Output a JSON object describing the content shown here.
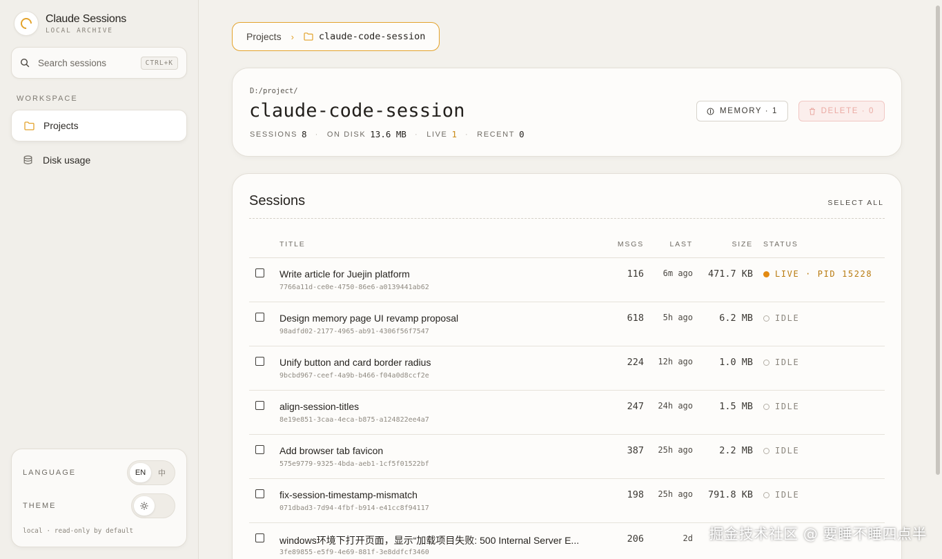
{
  "brand": {
    "title": "Claude Sessions",
    "subtitle": "LOCAL ARCHIVE"
  },
  "search": {
    "placeholder": "Search sessions",
    "shortcut": "CTRL+K"
  },
  "sidebar": {
    "section": "WORKSPACE",
    "items": [
      {
        "label": "Projects",
        "icon": "folder-icon",
        "active": true
      },
      {
        "label": "Disk usage",
        "icon": "database-icon",
        "active": false
      }
    ]
  },
  "settings": {
    "language_label": "LANGUAGE",
    "lang_options": [
      "EN",
      "中"
    ],
    "lang_selected": "EN",
    "theme_label": "THEME",
    "theme_icon": "sun-icon",
    "footnote": "local · read-only by default"
  },
  "breadcrumb": {
    "root": "Projects",
    "current": "claude-code-session"
  },
  "project": {
    "path": "D:/project/",
    "title": "claude-code-session",
    "stats": [
      {
        "label": "SESSIONS",
        "value": "8"
      },
      {
        "label": "ON DISK",
        "value": "13.6 MB"
      },
      {
        "label": "LIVE",
        "value": "1"
      },
      {
        "label": "RECENT",
        "value": "0"
      }
    ],
    "memory_button": "MEMORY · 1",
    "delete_button": "DELETE · 0"
  },
  "sessions": {
    "heading": "Sessions",
    "select_all": "SELECT ALL",
    "columns": {
      "title": "TITLE",
      "msgs": "MSGS",
      "last": "LAST",
      "size": "SIZE",
      "status": "STATUS"
    },
    "rows": [
      {
        "title": "Write article for Juejin platform",
        "id": "7766a11d-ce0e-4750-86e6-a0139441ab62",
        "msgs": "116",
        "last": "6m ago",
        "size": "471.7 KB",
        "status": "LIVE · PID 15228",
        "live": true
      },
      {
        "title": "Design memory page UI revamp proposal",
        "id": "98adfd02-2177-4965-ab91-4306f56f7547",
        "msgs": "618",
        "last": "5h ago",
        "size": "6.2 MB",
        "status": "IDLE",
        "live": false
      },
      {
        "title": "Unify button and card border radius",
        "id": "9bcbd967-ceef-4a9b-b466-f04a0d8ccf2e",
        "msgs": "224",
        "last": "12h ago",
        "size": "1.0 MB",
        "status": "IDLE",
        "live": false
      },
      {
        "title": "align-session-titles",
        "id": "8e19e851-3caa-4eca-b875-a124822ee4a7",
        "msgs": "247",
        "last": "24h ago",
        "size": "1.5 MB",
        "status": "IDLE",
        "live": false
      },
      {
        "title": "Add browser tab favicon",
        "id": "575e9779-9325-4bda-aeb1-1cf5f01522bf",
        "msgs": "387",
        "last": "25h ago",
        "size": "2.2 MB",
        "status": "IDLE",
        "live": false
      },
      {
        "title": "fix-session-timestamp-mismatch",
        "id": "071dbad3-7d94-4fbf-b914-e41cc8f94117",
        "msgs": "198",
        "last": "25h ago",
        "size": "791.8 KB",
        "status": "IDLE",
        "live": false
      },
      {
        "title": "windows环境下打开页面，显示“加载项目失败: 500 Internal Server E...",
        "id": "3fe89855-e5f9-4e69-881f-3e8ddfcf3460",
        "msgs": "206",
        "last": "2d",
        "size": "",
        "status": "",
        "live": false
      }
    ]
  },
  "watermark": "掘金技术社区 @ 要睡不睡四点半",
  "colors": {
    "accent": "#e3a22a",
    "live": "#e38a12",
    "danger": "#eaaaa3"
  }
}
